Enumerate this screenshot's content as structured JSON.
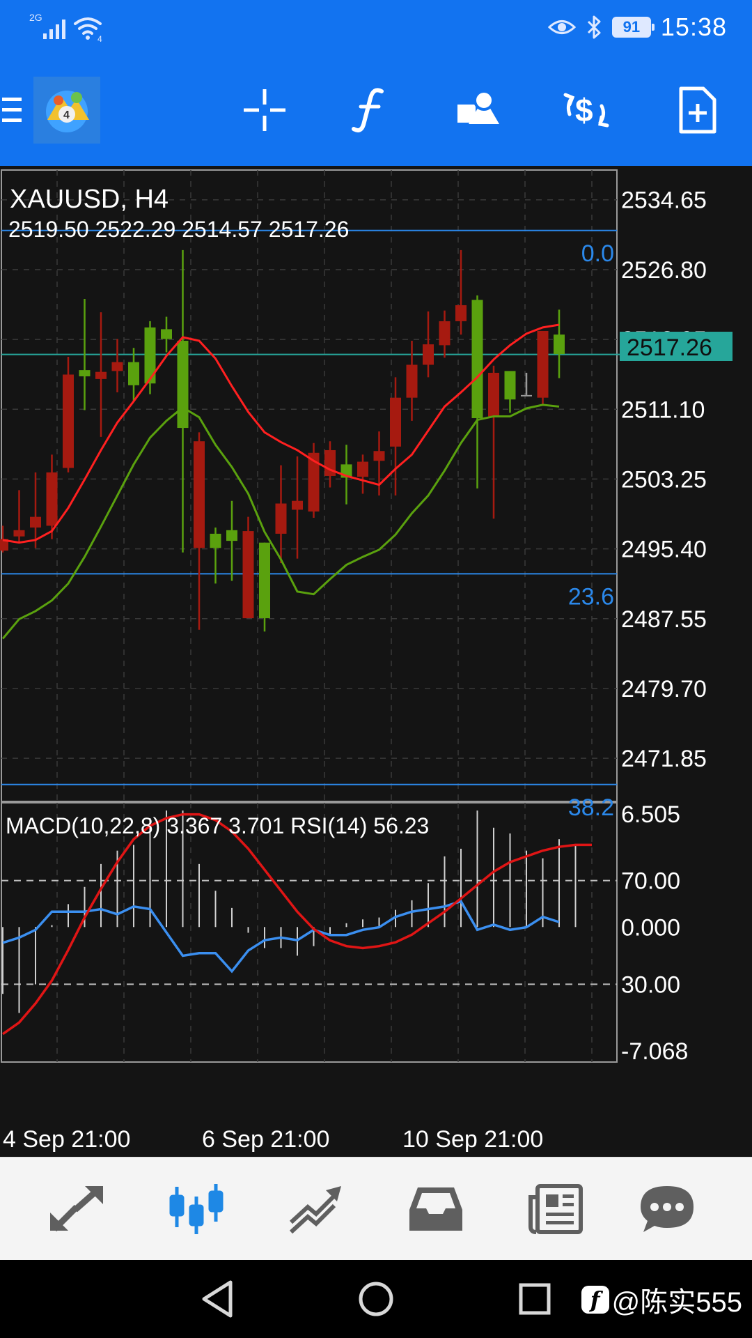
{
  "status_bar": {
    "network": "2G",
    "wifi_badge": "4",
    "battery": "91",
    "time": "15:38"
  },
  "toolbar": {
    "buttons": [
      "menu",
      "app-logo",
      "crosshair",
      "indicators",
      "objects",
      "trade",
      "new-order"
    ]
  },
  "chart": {
    "symbol": "XAUUSD, H4",
    "ohlc": "2519.50 2522.29 2514.57 2517.26",
    "current_price": "2517.26",
    "price_labels": [
      "2534.65",
      "2526.80",
      "2518.95",
      "2511.10",
      "2503.25",
      "2495.40",
      "2487.55",
      "2479.70",
      "2471.85"
    ],
    "fib_levels": [
      "0.0",
      "23.6",
      "38.2"
    ],
    "indicator_text": "MACD(10,22,8) 3.367 3.701 RSI(14) 56.23",
    "indicator_labels": [
      "6.505",
      "70.00",
      "0.000",
      "30.00",
      "-7.068"
    ],
    "time_labels": [
      "4 Sep 21:00",
      "6 Sep 21:00",
      "10 Sep 21:00"
    ],
    "colors": {
      "bull": "#5aa10e",
      "bear": "#a61a10",
      "ma_fast": "#ff2020",
      "ma_slow": "#5aa10e",
      "fib": "#2b88ea",
      "price_tag": "#26a69a",
      "rsi": "#3b8ff0",
      "signal": "#e01515"
    }
  },
  "chart_data": {
    "type": "candlestick",
    "title": "XAUUSD, H4",
    "ylim": [
      2467,
      2538
    ],
    "candles": [
      {
        "o": 2496.5,
        "h": 2498.0,
        "l": 2495.0,
        "c": 2495.2
      },
      {
        "o": 2497.5,
        "h": 2502.0,
        "l": 2496.0,
        "c": 2496.8
      },
      {
        "o": 2499.0,
        "h": 2504.0,
        "l": 2495.5,
        "c": 2497.8
      },
      {
        "o": 2504.0,
        "h": 2506.0,
        "l": 2496.5,
        "c": 2498.0
      },
      {
        "o": 2515.0,
        "h": 2517.0,
        "l": 2504.0,
        "c": 2504.5
      },
      {
        "o": 2514.8,
        "h": 2523.5,
        "l": 2511.0,
        "c": 2515.5
      },
      {
        "o": 2515.3,
        "h": 2522.0,
        "l": 2508.0,
        "c": 2514.5
      },
      {
        "o": 2516.4,
        "h": 2519.0,
        "l": 2513.0,
        "c": 2515.4
      },
      {
        "o": 2513.8,
        "h": 2518.0,
        "l": 2512.0,
        "c": 2516.4
      },
      {
        "o": 2514.0,
        "h": 2521.0,
        "l": 2512.8,
        "c": 2520.3
      },
      {
        "o": 2519.0,
        "h": 2521.5,
        "l": 2517.5,
        "c": 2520.1
      },
      {
        "o": 2509.0,
        "h": 2529.0,
        "l": 2495.0,
        "c": 2518.8
      },
      {
        "o": 2507.5,
        "h": 2508.5,
        "l": 2486.3,
        "c": 2495.5
      },
      {
        "o": 2495.5,
        "h": 2497.8,
        "l": 2491.5,
        "c": 2497.1
      },
      {
        "o": 2496.3,
        "h": 2500.8,
        "l": 2491.8,
        "c": 2497.5
      },
      {
        "o": 2497.4,
        "h": 2499.0,
        "l": 2488.3,
        "c": 2487.6
      },
      {
        "o": 2487.6,
        "h": 2496.1,
        "l": 2486.1,
        "c": 2496.1
      },
      {
        "o": 2500.5,
        "h": 2504.8,
        "l": 2493.8,
        "c": 2497.1
      },
      {
        "o": 2500.8,
        "h": 2505.8,
        "l": 2494.3,
        "c": 2499.8
      },
      {
        "o": 2506.2,
        "h": 2507.3,
        "l": 2498.9,
        "c": 2499.6
      },
      {
        "o": 2506.5,
        "h": 2507.5,
        "l": 2502.3,
        "c": 2503.6
      },
      {
        "o": 2503.4,
        "h": 2507.1,
        "l": 2500.4,
        "c": 2504.9
      },
      {
        "o": 2505.2,
        "h": 2506.0,
        "l": 2501.6,
        "c": 2503.5
      },
      {
        "o": 2506.4,
        "h": 2508.6,
        "l": 2501.4,
        "c": 2505.3
      },
      {
        "o": 2512.4,
        "h": 2514.7,
        "l": 2501.4,
        "c": 2506.9
      },
      {
        "o": 2516.1,
        "h": 2518.8,
        "l": 2509.8,
        "c": 2512.4
      },
      {
        "o": 2518.4,
        "h": 2522.1,
        "l": 2514.7,
        "c": 2516.1
      },
      {
        "o": 2521.0,
        "h": 2522.2,
        "l": 2516.9,
        "c": 2518.3
      },
      {
        "o": 2522.8,
        "h": 2529.0,
        "l": 2519.5,
        "c": 2521.0
      },
      {
        "o": 2510.1,
        "h": 2523.9,
        "l": 2502.2,
        "c": 2523.4
      },
      {
        "o": 2515.2,
        "h": 2516.0,
        "l": 2498.8,
        "c": 2510.3
      },
      {
        "o": 2512.2,
        "h": 2514.0,
        "l": 2510.7,
        "c": 2515.4
      },
      {
        "o": 2512.7,
        "h": 2515.2,
        "l": 2512.7,
        "c": 2512.7
      },
      {
        "o": 2519.9,
        "h": 2519.9,
        "l": 2511.6,
        "c": 2512.4
      },
      {
        "o": 2517.3,
        "h": 2522.3,
        "l": 2514.6,
        "c": 2519.5
      }
    ],
    "ma_fast": [
      2496.4,
      2496.1,
      2496.4,
      2497.4,
      2500.0,
      2503.2,
      2506.5,
      2509.6,
      2512.0,
      2514.5,
      2517.1,
      2519.2,
      2518.8,
      2516.8,
      2513.7,
      2510.8,
      2508.5,
      2507.4,
      2506.5,
      2505.3,
      2504.3,
      2503.6,
      2503.1,
      2502.6,
      2504.4,
      2506.0,
      2508.7,
      2511.4,
      2513.0,
      2514.7,
      2516.7,
      2518.3,
      2519.6,
      2520.3,
      2520.6
    ],
    "ma_slow": [
      2485.3,
      2487.5,
      2488.4,
      2489.6,
      2491.5,
      2494.5,
      2497.9,
      2501.4,
      2504.9,
      2507.9,
      2509.8,
      2511.3,
      2510.2,
      2507.1,
      2504.6,
      2501.6,
      2497.3,
      2494.2,
      2490.6,
      2490.3,
      2492.0,
      2493.6,
      2494.5,
      2495.3,
      2497.0,
      2499.4,
      2501.4,
      2504.2,
      2507.3,
      2509.9,
      2510.3,
      2510.3,
      2511.2,
      2511.6,
      2511.4
    ],
    "fib_levels": [
      {
        "level": "0.0",
        "price": 2531.2
      },
      {
        "level": "23.6",
        "price": 2492.6
      },
      {
        "level": "38.2",
        "price": 2468.9
      }
    ],
    "macd_hist": [
      -3.5,
      -4.5,
      -3.0,
      0.1,
      1.2,
      2.1,
      3.3,
      4.0,
      4.3,
      5.7,
      6.1,
      6.1,
      3.3,
      1.9,
      1.0,
      -0.3,
      -1.1,
      -1.1,
      -1.5,
      -1.0,
      -0.4,
      0.2,
      0.4,
      0.5,
      0.9,
      1.4,
      2.3,
      3.7,
      4.1,
      6.1,
      5.2,
      4.9,
      4.0,
      3.6,
      4.6,
      4.3
    ],
    "rsi": [
      46,
      48,
      51,
      58,
      58,
      58,
      59,
      57,
      60,
      59,
      50,
      41,
      42,
      42,
      35,
      43,
      47,
      48,
      47,
      51,
      49,
      49,
      51,
      52,
      56,
      58,
      59,
      60,
      62,
      51,
      53,
      51,
      52,
      56,
      54
    ],
    "signal": [
      -5.6,
      -5.0,
      -4.0,
      -2.8,
      -1.2,
      0.5,
      2.0,
      3.4,
      4.6,
      5.3,
      5.7,
      5.9,
      5.9,
      5.6,
      5.0,
      4.1,
      3.0,
      1.9,
      0.8,
      -0.1,
      -0.7,
      -1.0,
      -1.1,
      -1.0,
      -0.8,
      -0.4,
      0.2,
      0.8,
      1.5,
      2.2,
      2.9,
      3.4,
      3.7,
      4.0,
      4.2,
      4.3,
      4.3
    ],
    "indicator_ylim": [
      -7.068,
      6.505
    ],
    "time_labels": [
      "4 Sep 21:00",
      "6 Sep 21:00",
      "10 Sep 21:00"
    ]
  },
  "bottom_tabs": [
    "quotes",
    "chart",
    "trade",
    "history",
    "news",
    "messages"
  ],
  "nav": {
    "watermark": "@陈实555"
  }
}
